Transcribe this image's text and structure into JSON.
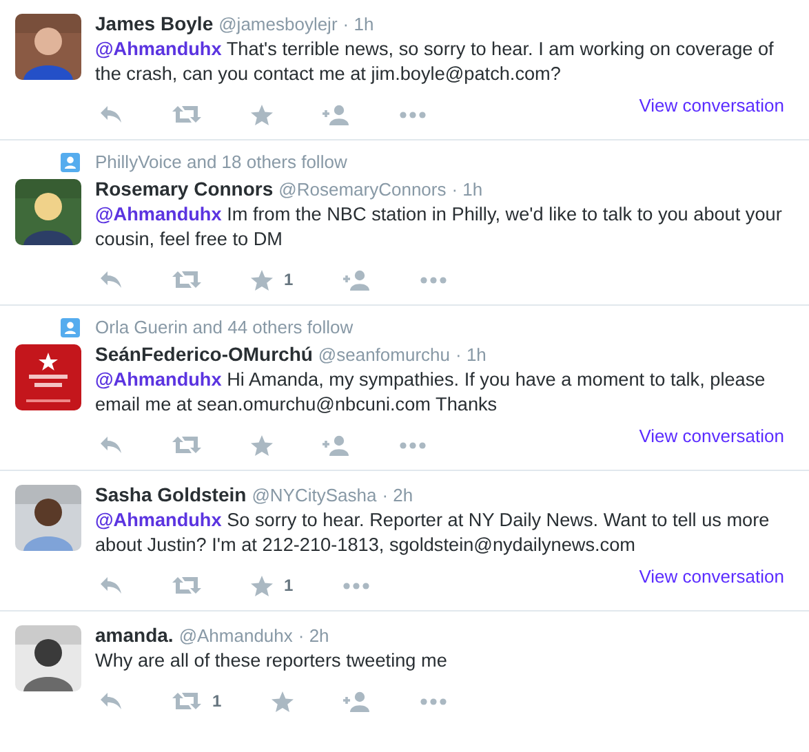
{
  "tweets": [
    {
      "name": "James Boyle",
      "handle": "@jamesboylejr",
      "time": "· 1h",
      "mention": "@Ahmanduhx",
      "text": " That's terrible news, so sorry to hear. I am working on coverage of the crash, can you contact me at jim.boyle@patch.com?",
      "view_conversation": "View conversation",
      "actions": [
        {
          "kind": "reply"
        },
        {
          "kind": "retweet"
        },
        {
          "kind": "favorite"
        },
        {
          "kind": "follow"
        },
        {
          "kind": "more"
        }
      ]
    },
    {
      "context": "PhillyVoice and 18 others follow",
      "name": "Rosemary Connors",
      "handle": "@RosemaryConnors",
      "time": "· 1h",
      "mention": "@Ahmanduhx",
      "text": " Im from the NBC station in Philly, we'd like to talk to you about your cousin, feel free to DM",
      "actions": [
        {
          "kind": "reply"
        },
        {
          "kind": "retweet"
        },
        {
          "kind": "favorite",
          "count": "1"
        },
        {
          "kind": "follow"
        },
        {
          "kind": "more"
        }
      ]
    },
    {
      "context": "Orla Guerin and 44 others follow",
      "name": "SeánFederico-OMurchú",
      "handle": "@seanfomurchu",
      "time": "· 1h",
      "mention": "@Ahmanduhx",
      "text": " Hi Amanda, my sympathies. If you have a moment to talk, please email me at sean.omurchu@nbcuni.com Thanks",
      "view_conversation": "View conversation",
      "actions": [
        {
          "kind": "reply"
        },
        {
          "kind": "retweet"
        },
        {
          "kind": "favorite"
        },
        {
          "kind": "follow"
        },
        {
          "kind": "more"
        }
      ]
    },
    {
      "name": "Sasha Goldstein",
      "handle": "@NYCitySasha",
      "time": "· 2h",
      "mention": "@Ahmanduhx",
      "text": " So sorry to hear. Reporter at NY Daily News. Want to tell us more about Justin? I'm at 212-210-1813, sgoldstein@nydailynews.com",
      "view_conversation": "View conversation",
      "actions": [
        {
          "kind": "reply"
        },
        {
          "kind": "retweet"
        },
        {
          "kind": "favorite",
          "count": "1"
        },
        {
          "kind": "more"
        }
      ]
    },
    {
      "name": "amanda.",
      "handle": "@Ahmanduhx",
      "time": "· 2h",
      "text": "Why are all of these reporters tweeting me",
      "actions": [
        {
          "kind": "reply"
        },
        {
          "kind": "retweet",
          "count": "1"
        },
        {
          "kind": "favorite"
        },
        {
          "kind": "follow"
        },
        {
          "kind": "more"
        }
      ]
    }
  ]
}
